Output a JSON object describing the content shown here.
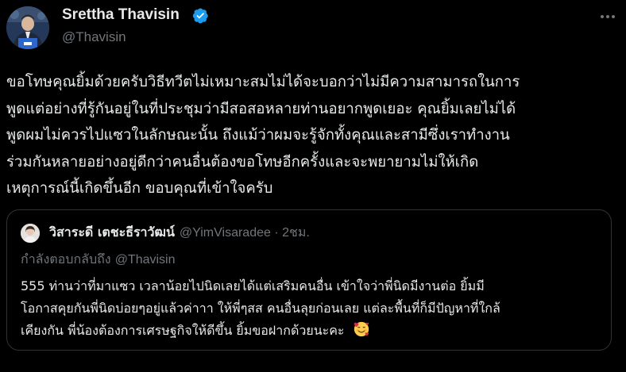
{
  "author": {
    "name": "Srettha Thavisin",
    "handle": "@Thavisin",
    "verified": true,
    "avatar_icon": "avatar-portrait"
  },
  "tweet": {
    "lines": [
      "ขอโทษคุณยิ้มด้วยครับวิธีทวีตไม่เหมาะสมไม่ได้จะบอกว่าไม่มีความสามารถในการ",
      "พูดแต่อย่างที่รู้กันอยู่ในที่ประชุมว่ามีสอสอหลายท่านอยากพูดเยอะ คุณยิ้มเลยไม่ได้",
      "พูดผมไม่ควรไปแซวในลักษณะนั้น ถึงแม้ว่าผมจะรู้จักทั้งคุณและสามีซึ่งเราทำงาน",
      "ร่วมกันหลายอย่างอยู่ดีกว่าคนอื่นต้องขอโทษอีกครั้งและจะพยายามไม่ให้เกิด",
      "เหตุการณ์นี้เกิดขึ้นอีก ขอบคุณที่เข้าใจครับ"
    ]
  },
  "quoted": {
    "name": "วิสาระดี เตชะธีราวัฒน์",
    "meta": "@YimVisaradee · 2ชม.",
    "reply_prefix": "กำลังตอบกลับถึง",
    "reply_mention": "@Thavisin",
    "lines": [
      "555 ท่านว่าที่มาแซว เวลาน้อยไปนิดเลยได้แต่เสริมคนอื่น เข้าใจว่าพี่นิดมีงานต่อ ยิ้มมี",
      "โอกาสคุยกันพี่นิดบ่อยๆอยู่แล้วค่าาา ให้พี่ๆสส คนอื่นลุยก่อนเลย แต่ละพื้นที่ก็มีปัญหาที่ใกล้",
      "เคียงกัน พี่น้องต้องการเศรษฐกิจให้ดีขึ้น ยิ้มขอฝากด้วยนะคะ"
    ],
    "emoji_icon": "smiling-face-with-hearts-emoji"
  },
  "colors": {
    "background": "#000000",
    "text_primary": "#e7e9ea",
    "text_secondary": "#71767b",
    "border": "#2f3336",
    "verified_blue": "#1d9bf0"
  }
}
